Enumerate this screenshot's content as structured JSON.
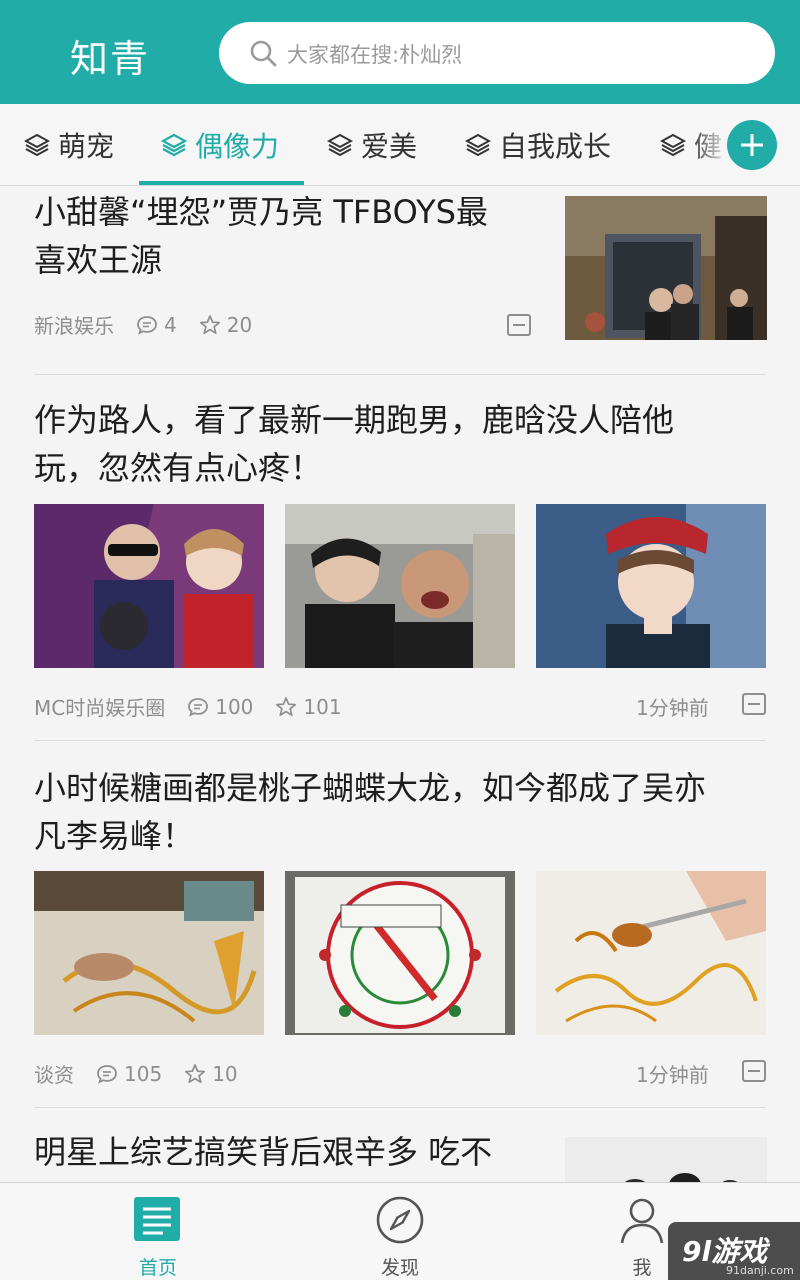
{
  "header": {
    "app_title": "知青",
    "search_placeholder": "大家都在搜:朴灿烈"
  },
  "tabs": [
    {
      "label": "萌宠",
      "active": false
    },
    {
      "label": "偶像力",
      "active": true
    },
    {
      "label": "爱美",
      "active": false
    },
    {
      "label": "自我成长",
      "active": false
    },
    {
      "label": "健",
      "active": false
    }
  ],
  "feed": [
    {
      "title_lines": [
        "小甜馨“埋怨”贾乃亮 TFBOYS最",
        "喜欢王源"
      ],
      "source": "新浪娱乐",
      "comments": "4",
      "stars": "20",
      "time": ""
    },
    {
      "title_lines": [
        "作为路人，看了最新一期跑男，鹿晗没人陪他",
        "玩，忽然有点心疼！"
      ],
      "source": "MC时尚娱乐圈",
      "comments": "100",
      "stars": "101",
      "time": "1分钟前"
    },
    {
      "title_lines": [
        "小时候糖画都是桃子蝴蝶大龙，如今都成了吴亦",
        "凡李易峰！"
      ],
      "source": "谈资",
      "comments": "105",
      "stars": "10",
      "time": "1分钟前"
    },
    {
      "title_lines": [
        "明星上综艺搞笑背后艰辛多 吃不"
      ]
    }
  ],
  "bottom_nav": [
    {
      "label": "首页",
      "icon": "home-list-icon",
      "active": true
    },
    {
      "label": "发现",
      "icon": "compass-icon",
      "active": false
    },
    {
      "label": "我",
      "icon": "person-icon",
      "active": false
    }
  ],
  "watermark": {
    "text": "9l游戏",
    "sub": "91danji.com"
  },
  "colors": {
    "accent": "#21aca8",
    "text": "#1e1e1e",
    "meta": "#8e8e8e"
  }
}
